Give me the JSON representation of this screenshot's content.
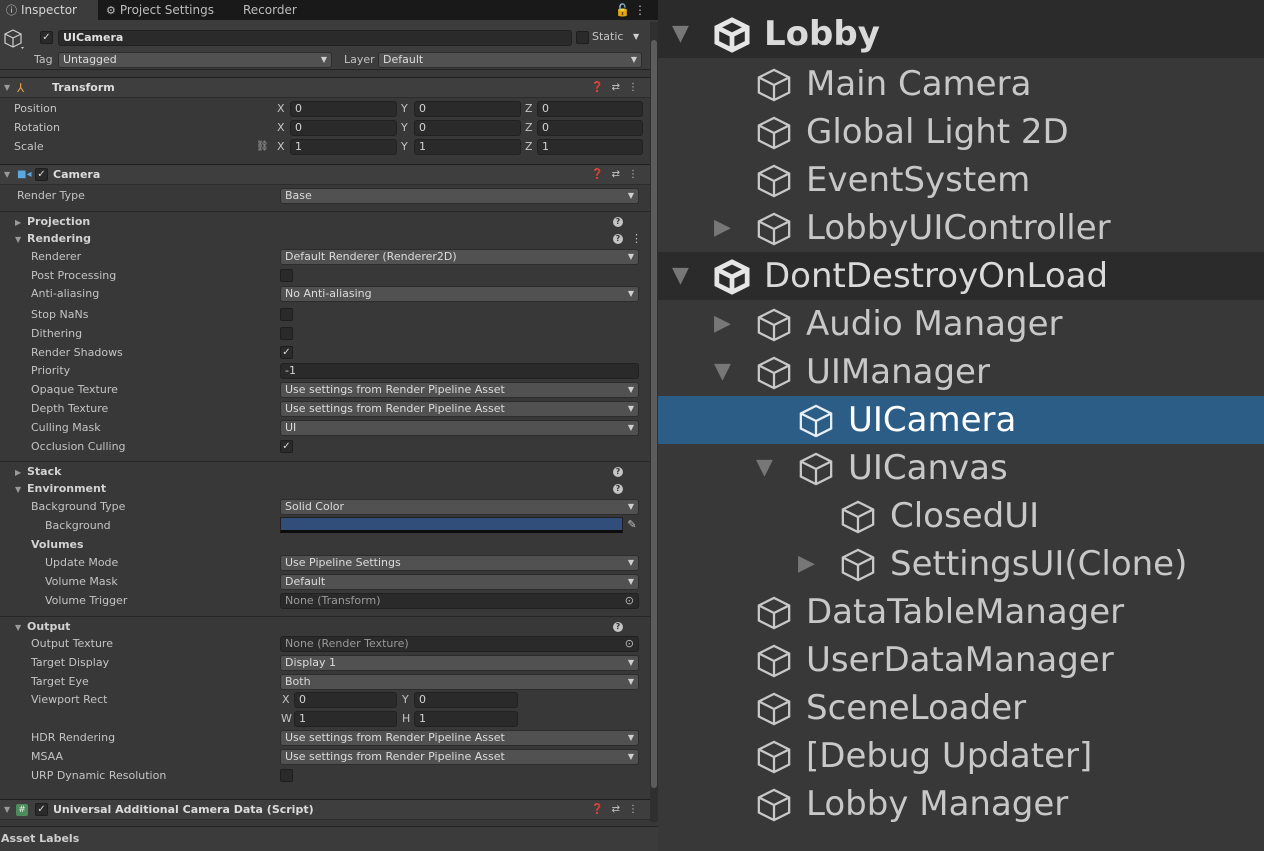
{
  "inspector": {
    "tabs": [
      {
        "label": "Inspector",
        "icon": "info-icon"
      },
      {
        "label": "Project Settings",
        "icon": "gear-icon"
      },
      {
        "label": "Recorder",
        "icon": ""
      }
    ],
    "gameobject": {
      "name": "UICamera",
      "active": "✓",
      "static_label": "Static",
      "tag_label": "Tag",
      "tag_value": "Untagged",
      "layer_label": "Layer",
      "layer_value": "Default"
    },
    "transform": {
      "title": "Transform",
      "position_label": "Position",
      "rotation_label": "Rotation",
      "scale_label": "Scale",
      "position": {
        "x": "0",
        "y": "0",
        "z": "0"
      },
      "rotation": {
        "x": "0",
        "y": "0",
        "z": "0"
      },
      "scale": {
        "x": "1",
        "y": "1",
        "z": "1"
      }
    },
    "axes": {
      "x": "X",
      "y": "Y",
      "z": "Z",
      "w": "W",
      "h": "H"
    },
    "camera": {
      "title": "Camera",
      "enabled": "✓",
      "render_type_label": "Render Type",
      "render_type": "Base",
      "projection_label": "Projection",
      "rendering_label": "Rendering",
      "renderer_label": "Renderer",
      "renderer": "Default Renderer (Renderer2D)",
      "post_processing_label": "Post Processing",
      "post_processing": "",
      "anti_aliasing_label": "Anti-aliasing",
      "anti_aliasing": "No Anti-aliasing",
      "stop_nans_label": "Stop NaNs",
      "stop_nans": "",
      "dithering_label": "Dithering",
      "dithering": "",
      "render_shadows_label": "Render Shadows",
      "render_shadows": "✓",
      "priority_label": "Priority",
      "priority": "-1",
      "opaque_texture_label": "Opaque Texture",
      "opaque_texture": "Use settings from Render Pipeline Asset",
      "depth_texture_label": "Depth Texture",
      "depth_texture": "Use settings from Render Pipeline Asset",
      "culling_mask_label": "Culling Mask",
      "culling_mask": "UI",
      "occlusion_culling_label": "Occlusion Culling",
      "occlusion_culling": "✓",
      "stack_label": "Stack",
      "environment_label": "Environment",
      "background_type_label": "Background Type",
      "background_type": "Solid Color",
      "background_label": "Background",
      "background_color": "#314d79",
      "volumes_label": "Volumes",
      "update_mode_label": "Update Mode",
      "update_mode": "Use Pipeline Settings",
      "volume_mask_label": "Volume Mask",
      "volume_mask": "Default",
      "volume_trigger_label": "Volume Trigger",
      "volume_trigger": "None (Transform)",
      "output_label": "Output",
      "output_texture_label": "Output Texture",
      "output_texture": "None (Render Texture)",
      "target_display_label": "Target Display",
      "target_display": "Display 1",
      "target_eye_label": "Target Eye",
      "target_eye": "Both",
      "viewport_rect_label": "Viewport Rect",
      "viewport": {
        "x": "0",
        "y": "0",
        "w": "1",
        "h": "1"
      },
      "hdr_rendering_label": "HDR Rendering",
      "hdr_rendering": "Use settings from Render Pipeline Asset",
      "msaa_label": "MSAA",
      "msaa": "Use settings from Render Pipeline Asset",
      "urp_dynamic_label": "URP Dynamic Resolution",
      "urp_dynamic": ""
    },
    "additional_data": {
      "title": "Universal Additional Camera Data (Script)",
      "enabled": "✓"
    },
    "asset_labels": "Asset Labels"
  },
  "hierarchy": {
    "items": [
      {
        "label": "Lobby",
        "type": "scene",
        "expanded": true
      },
      {
        "label": "Main Camera",
        "type": "object"
      },
      {
        "label": "Global Light 2D",
        "type": "object"
      },
      {
        "label": "EventSystem",
        "type": "object"
      },
      {
        "label": "LobbyUIController",
        "type": "object",
        "expanded": false
      },
      {
        "label": "DontDestroyOnLoad",
        "type": "scene",
        "expanded": true
      },
      {
        "label": "Audio Manager",
        "type": "object",
        "expanded": false
      },
      {
        "label": "UIManager",
        "type": "object",
        "expanded": true
      },
      {
        "label": "UICamera",
        "type": "object",
        "selected": true
      },
      {
        "label": "UICanvas",
        "type": "object",
        "expanded": true
      },
      {
        "label": "ClosedUI",
        "type": "object"
      },
      {
        "label": "SettingsUI(Clone)",
        "type": "object",
        "expanded": false
      },
      {
        "label": "DataTableManager",
        "type": "object"
      },
      {
        "label": "UserDataManager",
        "type": "object"
      },
      {
        "label": "SceneLoader",
        "type": "object"
      },
      {
        "label": "[Debug Updater]",
        "type": "object"
      },
      {
        "label": "Lobby Manager",
        "type": "object"
      }
    ],
    "selection_color": "#2c5d87"
  }
}
